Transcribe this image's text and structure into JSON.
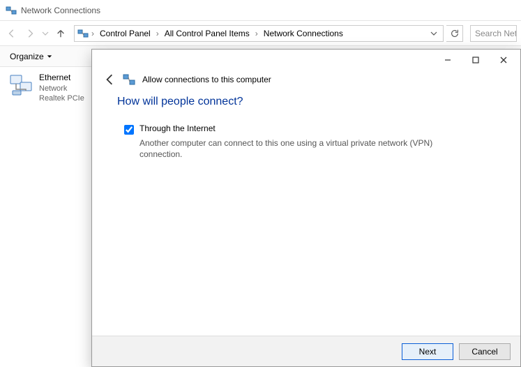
{
  "window": {
    "title": "Network Connections"
  },
  "breadcrumb": {
    "items": [
      "Control Panel",
      "All Control Panel Items",
      "Network Connections"
    ]
  },
  "search": {
    "placeholder": "Search Netw"
  },
  "toolbar": {
    "organize": "Organize"
  },
  "connection": {
    "name": "Ethernet",
    "status": "Network",
    "adapter": "Realtek PCIe"
  },
  "dialog": {
    "header": "Allow connections to this computer",
    "heading": "How will people connect?",
    "option_label": "Through the Internet",
    "option_desc": "Another computer can connect to this one using a virtual private network (VPN) connection.",
    "option_checked": true,
    "next": "Next",
    "cancel": "Cancel"
  }
}
